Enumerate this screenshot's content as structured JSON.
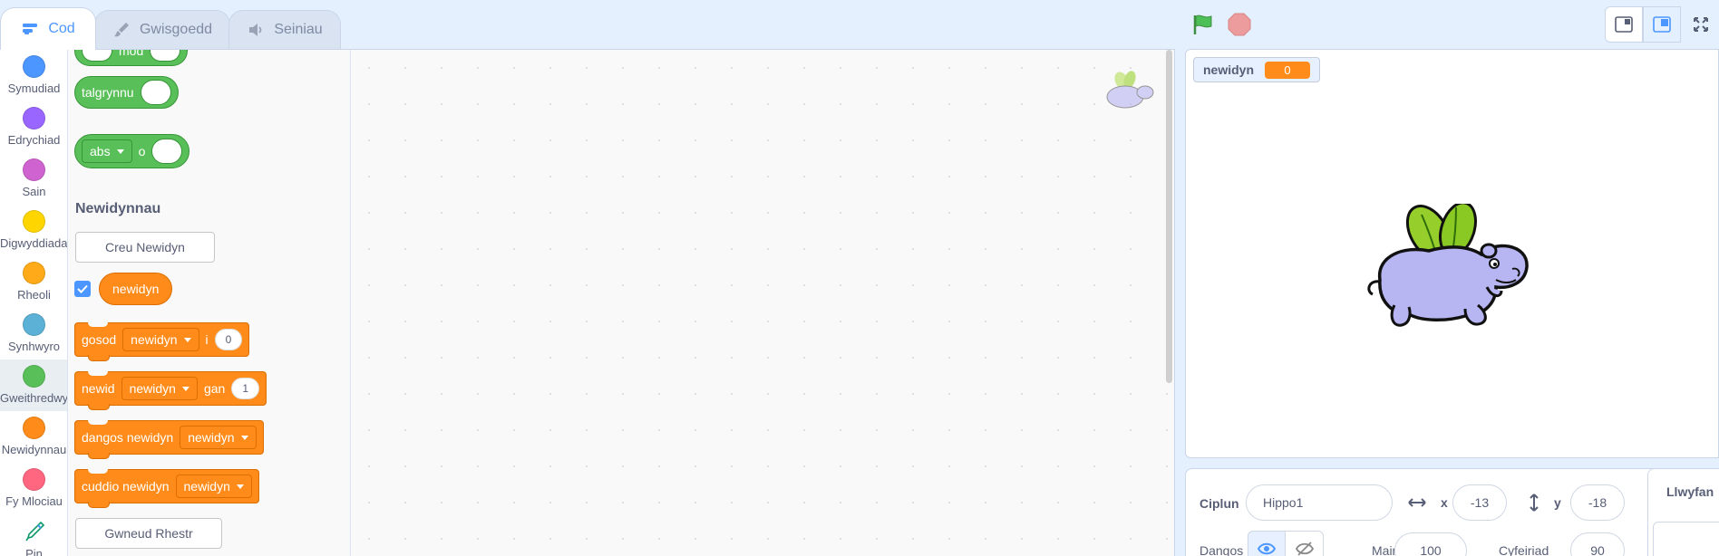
{
  "tabs": [
    {
      "label": "Cod",
      "icon": "code-icon",
      "active": true
    },
    {
      "label": "Gwisgoedd",
      "icon": "brush-icon",
      "active": false
    },
    {
      "label": "Seiniau",
      "icon": "speaker-icon",
      "active": false
    }
  ],
  "categories": [
    {
      "label": "Symudiad",
      "color": "#4c97ff"
    },
    {
      "label": "Edrychiad",
      "color": "#9966ff"
    },
    {
      "label": "Sain",
      "color": "#cf63cf"
    },
    {
      "label": "Digwyddiadau",
      "color": "#ffd500"
    },
    {
      "label": "Rheoli",
      "color": "#ffab19"
    },
    {
      "label": "Synhwyro",
      "color": "#5cb1d6"
    },
    {
      "label": "Gweithredwyr",
      "color": "#59c059",
      "selected": true
    },
    {
      "label": "Newidynnau",
      "color": "#ff8c1a"
    },
    {
      "label": "Fy Mlociau",
      "color": "#ff6680"
    },
    {
      "label": "Pin",
      "icon": "pen-icon"
    }
  ],
  "palette": {
    "mod_label": "mod",
    "round_label": "talgrynnu",
    "abs_label": "abs",
    "of_label": "o",
    "section_title": "Newidynnau",
    "make_variable_button": "Creu Newidyn",
    "variable_name": "newidyn",
    "set_block": {
      "verb": "gosod",
      "var": "newidyn",
      "to": "i",
      "value": "0"
    },
    "change_block": {
      "verb": "newid",
      "var": "newidyn",
      "by": "gan",
      "value": "1"
    },
    "show_block": {
      "verb": "dangos newidyn",
      "var": "newidyn"
    },
    "hide_block": {
      "verb": "cuddio newidyn",
      "var": "newidyn"
    },
    "make_list_button": "Gwneud Rhestr"
  },
  "stage": {
    "monitor_label": "newidyn",
    "monitor_value": "0"
  },
  "sprite_info": {
    "sprite_label": "Ciplun",
    "sprite_name": "Hippo1",
    "x_label": "x",
    "x_value": "-13",
    "y_label": "y",
    "y_value": "-18",
    "show_label": "Dangos",
    "size_label": "Maint",
    "size_value": "100",
    "direction_label": "Cyfeiriad",
    "direction_value": "90"
  },
  "backdrop_label": "Llwyfan",
  "colors": {
    "accent": "#4c97ff",
    "variables": "#ff8c1a",
    "operators": "#59c059",
    "flag": "#4cbf56",
    "stop": "#ec9c9c"
  }
}
